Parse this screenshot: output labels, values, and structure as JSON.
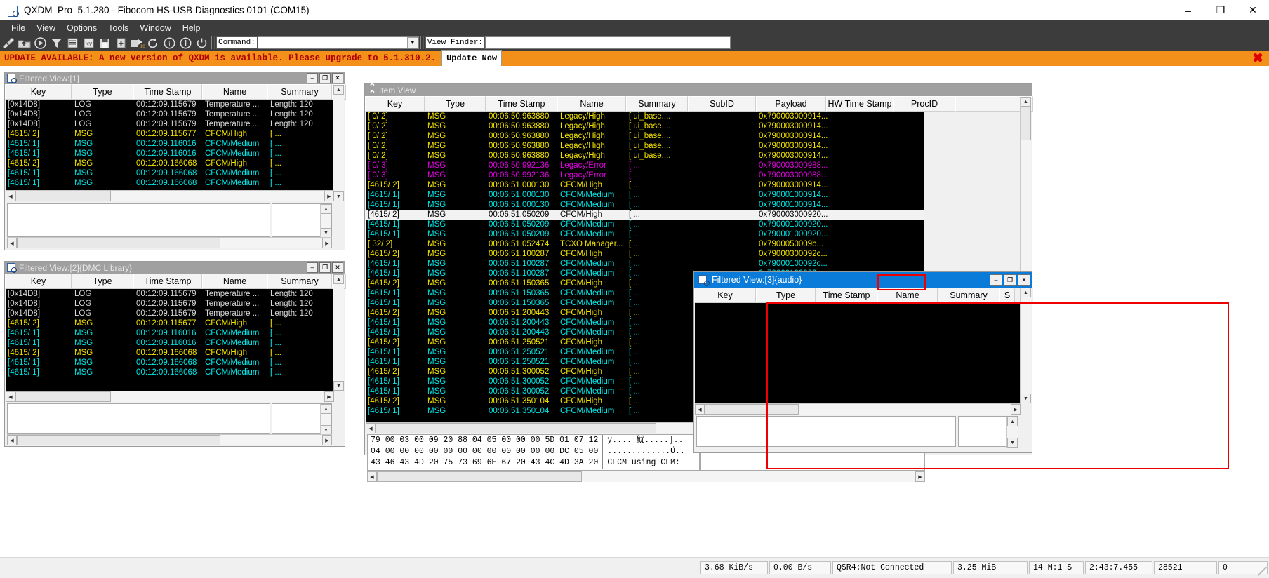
{
  "window": {
    "title": "QXDM_Pro_5.1.280 - Fibocom HS-USB Diagnostics 0101 (COM15)",
    "minimize": "–",
    "maximize": "❐",
    "close": "✕"
  },
  "menu": [
    {
      "label": "File"
    },
    {
      "label": "View"
    },
    {
      "label": "Options"
    },
    {
      "label": "Tools"
    },
    {
      "label": "Window"
    },
    {
      "label": "Help"
    }
  ],
  "toolbar": {
    "icons": [
      "connect-icon",
      "open-folder-icon",
      "play-icon",
      "filter-icon",
      "list-icon",
      "nv-browser-icon",
      "save-icon",
      "new-item-icon",
      "dm-convert-icon",
      "refresh-icon",
      "info-icon",
      "about-icon",
      "power-icon"
    ],
    "command_label": "Command:",
    "command_value": "",
    "command_dropdown": "▼",
    "viewfinder_label": "View Finder:",
    "viewfinder_value": ""
  },
  "banner": {
    "message": "UPDATE AVAILABLE: A new version of QXDM is available. Please upgrade to 5.1.310.2.",
    "button": "Update Now",
    "close": "✖",
    "bg_color": "#f39019",
    "text_color": "#b00000"
  },
  "filtered_view_1": {
    "title": "Filtered View:[1]",
    "columns": [
      "Key",
      "Type",
      "Time Stamp",
      "Name",
      "Summary"
    ],
    "rows": [
      {
        "key": "[0x14D8]",
        "type": "LOG",
        "ts": "00:12:09.115679",
        "name": "Temperature ...",
        "summary": "Length:  120",
        "color": "c-white"
      },
      {
        "key": "[0x14D8]",
        "type": "LOG",
        "ts": "00:12:09.115679",
        "name": "Temperature ...",
        "summary": "Length:  120",
        "color": "c-white"
      },
      {
        "key": "[0x14D8]",
        "type": "LOG",
        "ts": "00:12:09.115679",
        "name": "Temperature ...",
        "summary": "Length:  120",
        "color": "c-white"
      },
      {
        "key": "[4615/   2]",
        "type": "MSG",
        "ts": "00:12:09.115677",
        "name": "CFCM/High",
        "summary": "[   ...",
        "color": "c-yellow"
      },
      {
        "key": "[4615/   1]",
        "type": "MSG",
        "ts": "00:12:09.116016",
        "name": "CFCM/Medium",
        "summary": "[        ...",
        "color": "c-cyan"
      },
      {
        "key": "[4615/   1]",
        "type": "MSG",
        "ts": "00:12:09.116016",
        "name": "CFCM/Medium",
        "summary": "[        ...",
        "color": "c-cyan"
      },
      {
        "key": "[4615/   2]",
        "type": "MSG",
        "ts": "00:12:09.166068",
        "name": "CFCM/High",
        "summary": "[   ...",
        "color": "c-yellow"
      },
      {
        "key": "[4615/   1]",
        "type": "MSG",
        "ts": "00:12:09.166068",
        "name": "CFCM/Medium",
        "summary": "[        ...",
        "color": "c-cyan"
      },
      {
        "key": "[4615/   1]",
        "type": "MSG",
        "ts": "00:12:09.166068",
        "name": "CFCM/Medium",
        "summary": "[        ...",
        "color": "c-cyan"
      }
    ]
  },
  "filtered_view_2": {
    "title": "Filtered View:[2]{DMC Library}",
    "columns": [
      "Key",
      "Type",
      "Time Stamp",
      "Name",
      "Summary"
    ],
    "rows": [
      {
        "key": "[0x14D8]",
        "type": "LOG",
        "ts": "00:12:09.115679",
        "name": "Temperature ...",
        "summary": "Length:  120",
        "color": "c-white"
      },
      {
        "key": "[0x14D8]",
        "type": "LOG",
        "ts": "00:12:09.115679",
        "name": "Temperature ...",
        "summary": "Length:  120",
        "color": "c-white"
      },
      {
        "key": "[0x14D8]",
        "type": "LOG",
        "ts": "00:12:09.115679",
        "name": "Temperature ...",
        "summary": "Length:  120",
        "color": "c-white"
      },
      {
        "key": "[4615/   2]",
        "type": "MSG",
        "ts": "00:12:09.115677",
        "name": "CFCM/High",
        "summary": "[   ...",
        "color": "c-yellow"
      },
      {
        "key": "[4615/   1]",
        "type": "MSG",
        "ts": "00:12:09.116016",
        "name": "CFCM/Medium",
        "summary": "[        ...",
        "color": "c-cyan"
      },
      {
        "key": "[4615/   1]",
        "type": "MSG",
        "ts": "00:12:09.116016",
        "name": "CFCM/Medium",
        "summary": "[        ...",
        "color": "c-cyan"
      },
      {
        "key": "[4615/   2]",
        "type": "MSG",
        "ts": "00:12:09.166068",
        "name": "CFCM/High",
        "summary": "[   ...",
        "color": "c-yellow"
      },
      {
        "key": "[4615/   1]",
        "type": "MSG",
        "ts": "00:12:09.166068",
        "name": "CFCM/Medium",
        "summary": "[        ...",
        "color": "c-cyan"
      },
      {
        "key": "[4615/   1]",
        "type": "MSG",
        "ts": "00:12:09.166068",
        "name": "CFCM/Medium",
        "summary": "[        ...",
        "color": "c-cyan"
      }
    ]
  },
  "item_view": {
    "title": "Item View",
    "columns": [
      "Key",
      "Type",
      "Time Stamp",
      "Name",
      "Summary",
      "SubID",
      "Payload",
      "HW Time Stamp",
      "ProcID"
    ],
    "rows": [
      {
        "key": "[   0/   2]",
        "type": "MSG",
        "ts": "00:06:50.963880",
        "name": "Legacy/High",
        "summary": "[       ui_base....",
        "subid": "",
        "payload": "0x790003000914...",
        "color": "c-yellow",
        "selected": false
      },
      {
        "key": "[   0/   2]",
        "type": "MSG",
        "ts": "00:06:50.963880",
        "name": "Legacy/High",
        "summary": "[       ui_base....",
        "subid": "",
        "payload": "0x790003000914...",
        "color": "c-yellow",
        "selected": false
      },
      {
        "key": "[   0/   2]",
        "type": "MSG",
        "ts": "00:06:50.963880",
        "name": "Legacy/High",
        "summary": "[       ui_base....",
        "subid": "",
        "payload": "0x790003000914...",
        "color": "c-yellow",
        "selected": false
      },
      {
        "key": "[   0/   2]",
        "type": "MSG",
        "ts": "00:06:50.963880",
        "name": "Legacy/High",
        "summary": "[       ui_base....",
        "subid": "",
        "payload": "0x790003000914...",
        "color": "c-yellow",
        "selected": false
      },
      {
        "key": "[   0/   2]",
        "type": "MSG",
        "ts": "00:06:50.963880",
        "name": "Legacy/High",
        "summary": "[       ui_base....",
        "subid": "",
        "payload": "0x790003000914...",
        "color": "c-yellow",
        "selected": false
      },
      {
        "key": "[   0/   3]",
        "type": "MSG",
        "ts": "00:06:50.992136",
        "name": "Legacy/Error",
        "summary": "[       ...",
        "subid": "",
        "payload": "0x790003000988...",
        "color": "c-magenta",
        "selected": false
      },
      {
        "key": "[   0/   3]",
        "type": "MSG",
        "ts": "00:06:50.992136",
        "name": "Legacy/Error",
        "summary": "[       ...",
        "subid": "",
        "payload": "0x790003000988...",
        "color": "c-magenta",
        "selected": false
      },
      {
        "key": "[4615/   2]",
        "type": "MSG",
        "ts": "00:06:51.000130",
        "name": "CFCM/High",
        "summary": "[ ...",
        "subid": "",
        "payload": "0x790003000914...",
        "color": "c-yellow",
        "selected": false
      },
      {
        "key": "[4615/   1]",
        "type": "MSG",
        "ts": "00:06:51.000130",
        "name": "CFCM/Medium",
        "summary": "[      ...",
        "subid": "",
        "payload": "0x790001000914...",
        "color": "c-cyan",
        "selected": false
      },
      {
        "key": "[4615/   1]",
        "type": "MSG",
        "ts": "00:06:51.000130",
        "name": "CFCM/Medium",
        "summary": "[      ...",
        "subid": "",
        "payload": "0x790001000914...",
        "color": "c-cyan",
        "selected": false
      },
      {
        "key": "[4615/   2]",
        "type": "MSG",
        "ts": "00:06:51.050209",
        "name": "CFCM/High",
        "summary": "[ ...",
        "subid": "",
        "payload": "0x790003000920...",
        "color": "c-black",
        "selected": true
      },
      {
        "key": "[4615/   1]",
        "type": "MSG",
        "ts": "00:06:51.050209",
        "name": "CFCM/Medium",
        "summary": "[      ...",
        "subid": "",
        "payload": "0x790001000920...",
        "color": "c-cyan",
        "selected": false
      },
      {
        "key": "[4615/   1]",
        "type": "MSG",
        "ts": "00:06:51.050209",
        "name": "CFCM/Medium",
        "summary": "[      ...",
        "subid": "",
        "payload": "0x790001000920...",
        "color": "c-cyan",
        "selected": false
      },
      {
        "key": "[  32/   2]",
        "type": "MSG",
        "ts": "00:06:51.052474",
        "name": "TCXO Manager...",
        "summary": "[    ...",
        "subid": "",
        "payload": "0x7900050009b...",
        "color": "c-yellow",
        "selected": false
      },
      {
        "key": "[4615/   2]",
        "type": "MSG",
        "ts": "00:06:51.100287",
        "name": "CFCM/High",
        "summary": "[ ...",
        "subid": "",
        "payload": "0x79000300092c...",
        "color": "c-yellow",
        "selected": false
      },
      {
        "key": "[4615/   1]",
        "type": "MSG",
        "ts": "00:06:51.100287",
        "name": "CFCM/Medium",
        "summary": "[      ...",
        "subid": "",
        "payload": "0x79000100092c...",
        "color": "c-cyan",
        "selected": false
      },
      {
        "key": "[4615/   1]",
        "type": "MSG",
        "ts": "00:06:51.100287",
        "name": "CFCM/Medium",
        "summary": "[      ...",
        "subid": "",
        "payload": "0x79000100092c...",
        "color": "c-cyan",
        "selected": false
      },
      {
        "key": "[4615/   2]",
        "type": "MSG",
        "ts": "00:06:51.150365",
        "name": "CFCM/High",
        "summary": "[ ...",
        "subid": "",
        "payload": "",
        "color": "c-yellow",
        "selected": false
      },
      {
        "key": "[4615/   1]",
        "type": "MSG",
        "ts": "00:06:51.150365",
        "name": "CFCM/Medium",
        "summary": "[      ...",
        "subid": "",
        "payload": "",
        "color": "c-cyan",
        "selected": false
      },
      {
        "key": "[4615/   1]",
        "type": "MSG",
        "ts": "00:06:51.150365",
        "name": "CFCM/Medium",
        "summary": "[      ...",
        "subid": "",
        "payload": "",
        "color": "c-cyan",
        "selected": false
      },
      {
        "key": "[4615/   2]",
        "type": "MSG",
        "ts": "00:06:51.200443",
        "name": "CFCM/High",
        "summary": "[ ...",
        "subid": "",
        "payload": "",
        "color": "c-yellow",
        "selected": false
      },
      {
        "key": "[4615/   1]",
        "type": "MSG",
        "ts": "00:06:51.200443",
        "name": "CFCM/Medium",
        "summary": "[      ...",
        "subid": "",
        "payload": "",
        "color": "c-cyan",
        "selected": false
      },
      {
        "key": "[4615/   1]",
        "type": "MSG",
        "ts": "00:06:51.200443",
        "name": "CFCM/Medium",
        "summary": "[      ...",
        "subid": "",
        "payload": "",
        "color": "c-cyan",
        "selected": false
      },
      {
        "key": "[4615/   2]",
        "type": "MSG",
        "ts": "00:06:51.250521",
        "name": "CFCM/High",
        "summary": "[ ...",
        "subid": "",
        "payload": "",
        "color": "c-yellow",
        "selected": false
      },
      {
        "key": "[4615/   1]",
        "type": "MSG",
        "ts": "00:06:51.250521",
        "name": "CFCM/Medium",
        "summary": "[      ...",
        "subid": "",
        "payload": "",
        "color": "c-cyan",
        "selected": false
      },
      {
        "key": "[4615/   1]",
        "type": "MSG",
        "ts": "00:06:51.250521",
        "name": "CFCM/Medium",
        "summary": "[      ...",
        "subid": "",
        "payload": "",
        "color": "c-cyan",
        "selected": false
      },
      {
        "key": "[4615/   2]",
        "type": "MSG",
        "ts": "00:06:51.300052",
        "name": "CFCM/High",
        "summary": "[ ...",
        "subid": "",
        "payload": "",
        "color": "c-yellow",
        "selected": false
      },
      {
        "key": "[4615/   1]",
        "type": "MSG",
        "ts": "00:06:51.300052",
        "name": "CFCM/Medium",
        "summary": "[      ...",
        "subid": "",
        "payload": "",
        "color": "c-cyan",
        "selected": false
      },
      {
        "key": "[4615/   1]",
        "type": "MSG",
        "ts": "00:06:51.300052",
        "name": "CFCM/Medium",
        "summary": "[      ...",
        "subid": "",
        "payload": "",
        "color": "c-cyan",
        "selected": false
      },
      {
        "key": "[4615/   2]",
        "type": "MSG",
        "ts": "00:06:51.350104",
        "name": "CFCM/High",
        "summary": "[ ...",
        "subid": "",
        "payload": "",
        "color": "c-yellow",
        "selected": false
      },
      {
        "key": "[4615/   1]",
        "type": "MSG",
        "ts": "00:06:51.350104",
        "name": "CFCM/Medium",
        "summary": "[      ...",
        "subid": "",
        "payload": "",
        "color": "c-cyan",
        "selected": false
      }
    ],
    "hex_dump": [
      {
        "bytes": "79 00 03 00 09 20 88 04 05 00 00 00 5D 01 07 12",
        "ascii": "y.... 鱿.....].."
      },
      {
        "bytes": "04 00 00 00 00 00 00 00 00 00 00 00 00 DC 05 00",
        "ascii": ".............Ü.."
      },
      {
        "bytes": "43 46 43 4D 20 75 73 69 6E 67 20 43 4C 4D 3A 20",
        "ascii": "CFCM using CLM: "
      }
    ]
  },
  "filtered_view_3": {
    "title": "Filtered View:[3]{audio}",
    "columns": [
      "Key",
      "Type",
      "Time Stamp",
      "Name",
      "Summary",
      "S"
    ],
    "rows": []
  },
  "statusbar": {
    "cells": [
      "3.68 KiB/s",
      "0.00 B/s",
      "QSR4:Not Connected",
      "3.25 MiB",
      "14 M:1 S",
      "2:43:7.455",
      "28521",
      "0"
    ]
  }
}
